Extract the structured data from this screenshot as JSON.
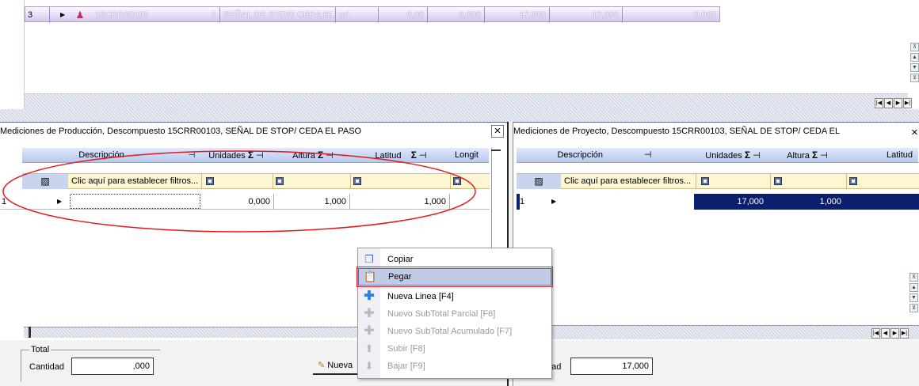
{
  "top_grid": {
    "row": {
      "num": "3",
      "indicator": "▶",
      "code": "15CRR00103",
      "qty": "1",
      "desc": "SEÑAL DE STOP/ CEDA EL...",
      "unit": "ud",
      "v1": "0,00",
      "v2": "0,000",
      "v3": "17,000",
      "v4": "17,000",
      "v5": "0,000"
    }
  },
  "prod_panel": {
    "title": "Mediciones de Producción, Descompuesto 15CRR00103, SEÑAL DE STOP/ CEDA EL PASO",
    "close": "×",
    "columns": {
      "desc": "Descripción",
      "units": "Unidades",
      "height": "Altura",
      "lat": "Latitud",
      "long": "Longit"
    },
    "sigma": "Σ",
    "pin": "ꟷ",
    "filter_text": "Clic aquí para establecer filtros...",
    "row": {
      "num": "1",
      "indicator": "▶",
      "desc": "",
      "units": "0,000",
      "height": "1,000",
      "lat": "1,000"
    }
  },
  "proj_panel": {
    "title": "Mediciones de Proyecto, Descompuesto 15CRR00103, SEÑAL DE STOP/ CEDA EL",
    "close": "×",
    "columns": {
      "desc": "Descripción",
      "units": "Unidades",
      "height": "Altura",
      "lat": "Latitud"
    },
    "filter_text": "Clic aquí para establecer filtros...",
    "row": {
      "num": "1",
      "indicator": "▶",
      "units": "17,000",
      "height": "1,000"
    }
  },
  "total": {
    "legend": "Total",
    "label": "Cantidad",
    "value": ",000",
    "new_button": "Nueva",
    "proj_label": "dad",
    "proj_value": "17,000"
  },
  "context_menu": {
    "items": [
      {
        "label": "Copiar",
        "enabled": true,
        "icon": "copy-icon"
      },
      {
        "label": "Pegar",
        "enabled": true,
        "icon": "paste-icon"
      },
      {
        "label": "Nueva Linea [F4]",
        "enabled": true,
        "icon": "plus-icon"
      },
      {
        "label": "Nuevo SubTotal Parcial [F6]",
        "enabled": false,
        "icon": "plus-icon"
      },
      {
        "label": "Nuevo SubTotal Acumulado [F7]",
        "enabled": false,
        "icon": "plus-icon"
      },
      {
        "label": "Subir [F8]",
        "enabled": false,
        "icon": "arrow-up-icon"
      },
      {
        "label": "Bajar [F9]",
        "enabled": false,
        "icon": "arrow-down-icon"
      }
    ]
  },
  "colors": {
    "header_row": "#d9c8f0",
    "selected_row": "#0c1f6e",
    "highlight": "#e21a1a",
    "menu_hover": "#c2cbe6"
  }
}
